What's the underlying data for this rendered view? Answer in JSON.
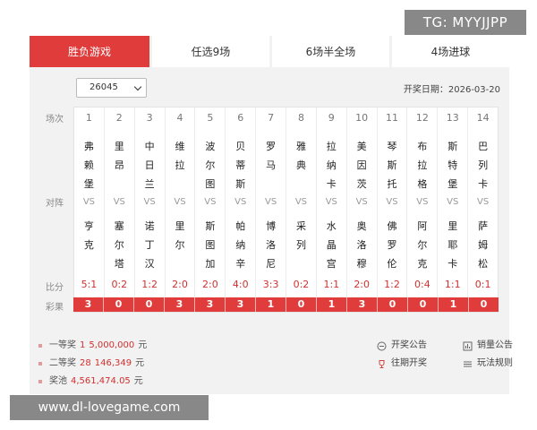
{
  "watermarks": {
    "top": "TG: MYYJJPP",
    "bottom": "www.dl-lovegame.com"
  },
  "tabs": [
    {
      "label": "胜负游戏",
      "active": true
    },
    {
      "label": "任选9场",
      "active": false
    },
    {
      "label": "6场半全场",
      "active": false
    },
    {
      "label": "4场进球",
      "active": false
    }
  ],
  "issue_select": {
    "value": "26045"
  },
  "draw_date": "开奖日期：2026-03-20",
  "row_labels": {
    "match": "场次",
    "vs": "对阵",
    "score": "比分",
    "result": "彩果"
  },
  "vs_text": "VS",
  "matches": [
    {
      "num": "1",
      "home": "弗赖堡",
      "away": "亨克",
      "score": "5:1",
      "result": "3"
    },
    {
      "num": "2",
      "home": "里昂",
      "away": "塞尔塔",
      "score": "0:2",
      "result": "0"
    },
    {
      "num": "3",
      "home": "中日兰",
      "away": "诺丁汉",
      "score": "1:2",
      "result": "0"
    },
    {
      "num": "4",
      "home": "维拉",
      "away": "里尔",
      "score": "2:0",
      "result": "3"
    },
    {
      "num": "5",
      "home": "波尔图",
      "away": "斯图加",
      "score": "2:0",
      "result": "3"
    },
    {
      "num": "6",
      "home": "贝蒂斯",
      "away": "帕纳辛",
      "score": "4:0",
      "result": "3"
    },
    {
      "num": "7",
      "home": "罗马",
      "away": "博洛尼",
      "score": "3:3",
      "result": "1"
    },
    {
      "num": "8",
      "home": "雅典",
      "away": "采列",
      "score": "0:2",
      "result": "0"
    },
    {
      "num": "9",
      "home": "拉纳卡",
      "away": "水晶宫",
      "score": "1:1",
      "result": "1"
    },
    {
      "num": "10",
      "home": "美因茨",
      "away": "奥洛穆",
      "score": "2:0",
      "result": "3"
    },
    {
      "num": "11",
      "home": "琴斯托",
      "away": "佛罗伦",
      "score": "1:2",
      "result": "0"
    },
    {
      "num": "12",
      "home": "布拉格",
      "away": "阿尔克",
      "score": "0:4",
      "result": "0"
    },
    {
      "num": "13",
      "home": "斯特堡",
      "away": "里耶卡",
      "score": "1:1",
      "result": "1"
    },
    {
      "num": "14",
      "home": "巴列卡",
      "away": "萨姆松",
      "score": "0:1",
      "result": "0"
    }
  ],
  "prizes": [
    {
      "label": "一等奖",
      "count": "1",
      "amount": "5,000,000",
      "unit": "元"
    },
    {
      "label": "二等奖",
      "count": "28",
      "amount": "146,349",
      "unit": "元"
    }
  ],
  "pool": {
    "label": "奖池",
    "amount": "4,561,474.05",
    "unit": "元"
  },
  "links": {
    "announcement": {
      "label": "开奖公告",
      "icon": "announcement-icon"
    },
    "sales": {
      "label": "销量公告",
      "icon": "sales-icon"
    },
    "history": {
      "label": "往期开奖",
      "icon": "trophy-icon"
    },
    "rules": {
      "label": "玩法规则",
      "icon": "rules-icon"
    }
  },
  "colors": {
    "accent": "#e03c3c",
    "score_red": "#d0302f"
  }
}
